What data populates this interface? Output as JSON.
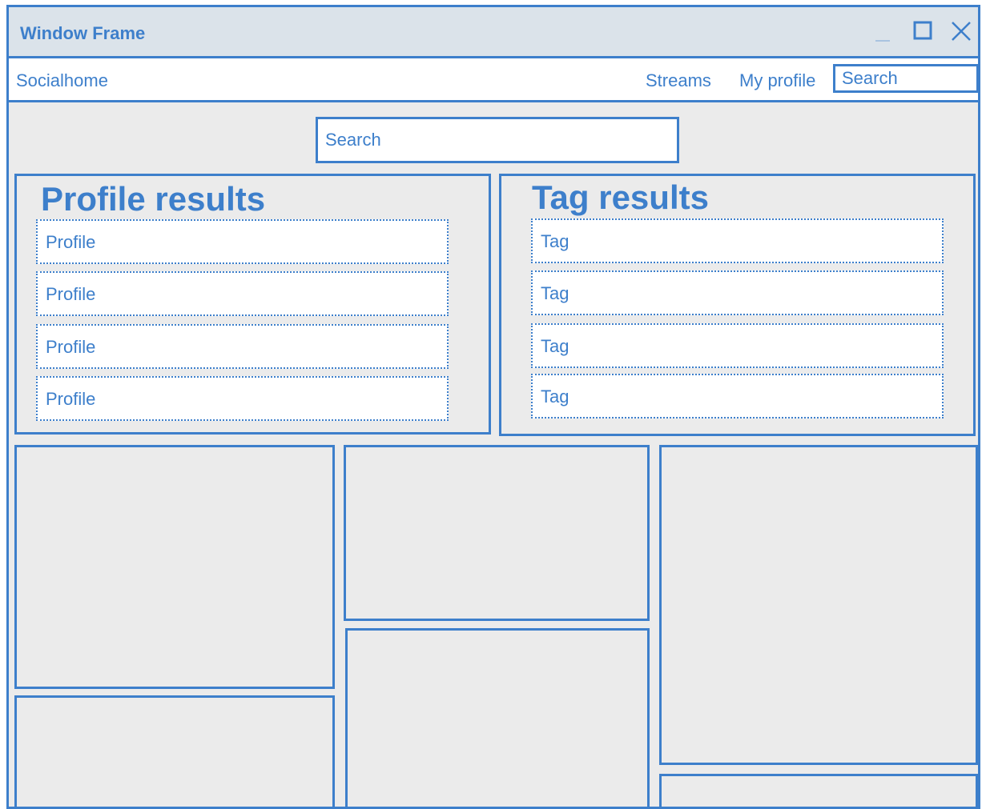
{
  "window": {
    "title": "Window Frame",
    "controls": [
      "minimize-icon",
      "maximize-icon",
      "close-icon"
    ]
  },
  "navbar": {
    "brand": "Socialhome",
    "links": [
      "Streams",
      "My profile"
    ],
    "search_placeholder": "Search"
  },
  "main": {
    "search_placeholder": "Search",
    "profile_results": {
      "title": "Profile results",
      "items": [
        "Profile",
        "Profile",
        "Profile",
        "Profile"
      ]
    },
    "tag_results": {
      "title": "Tag results",
      "items": [
        "Tag",
        "Tag",
        "Tag",
        "Tag"
      ]
    }
  },
  "colors": {
    "accent": "#3d7fcb",
    "background": "#ebebeb",
    "titlebar": "#dbe3ea",
    "surface": "#ffffff"
  }
}
